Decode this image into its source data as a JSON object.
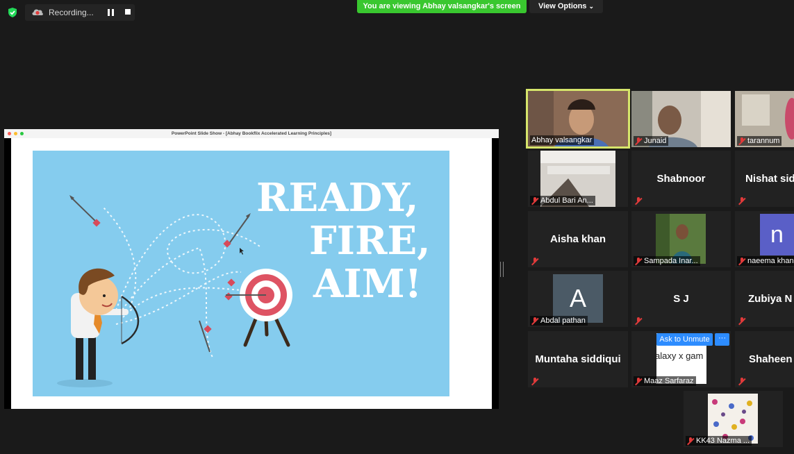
{
  "topbar": {
    "recording_label": "Recording...",
    "viewing_banner": "You are viewing Abhay valsangkar's screen",
    "view_options": "View Options"
  },
  "share": {
    "window_title": "PowerPoint Slide Show - [Abhay Bookflix Accelerated Learning Principles]",
    "slide_lines": [
      "READY,",
      "FIRE,",
      "AIM!"
    ]
  },
  "participants": {
    "abhay": "Abhay valsangkar",
    "junaid": "Junaid",
    "tarannum": "tarannum",
    "abdul": "Abdul Bari An...",
    "shabnoor": "Shabnoor",
    "nishat": "Nishat sid",
    "aisha": "Aisha khan",
    "sampada": "Sampada Inar...",
    "naeema": "naeema khan",
    "naeema_initial": "n",
    "abdal": "Abdal pathan",
    "abdal_initial": "A",
    "sj": "S J",
    "zubiya": "Zubiya N",
    "muntaha": "Muntaha siddiqui",
    "maaz": "Maaz Sarfaraz",
    "maaz_screen_text": "alaxy x gam",
    "shaheen": "Shaheen",
    "kk43": "KK43 Nazma ..."
  },
  "ask_to_unmute": "Ask to Unmute",
  "more_button": "···",
  "colors": {
    "viewing_green": "#39c72f",
    "active_speaker": "#d6e56b",
    "mic_muted": "#e03a3a",
    "slide_blue": "#85ccee",
    "zoom_blue": "#2d8cff"
  }
}
